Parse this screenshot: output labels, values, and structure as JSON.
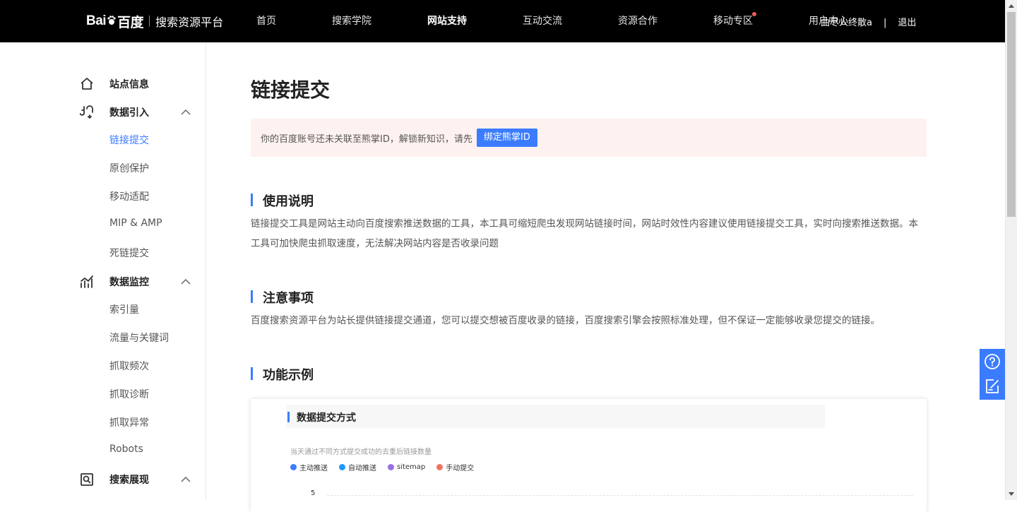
{
  "header": {
    "logo_mark": "Bai",
    "logo_mark2": "百度",
    "platform_name": "搜索资源平台",
    "nav": [
      {
        "label": "首页"
      },
      {
        "label": "搜索学院"
      },
      {
        "label": "网站支持"
      },
      {
        "label": "互动交流"
      },
      {
        "label": "资源合作"
      },
      {
        "label": "移动专区"
      },
      {
        "label": "用户中心"
      }
    ],
    "username": "曲尽人终散a",
    "separator": "|",
    "logout": "退出"
  },
  "sidebar": {
    "site_info": "站点信息",
    "data_import": {
      "title": "数据引入",
      "items": [
        "链接提交",
        "原创保护",
        "移动适配",
        "MIP & AMP",
        "死链提交"
      ]
    },
    "data_monitor": {
      "title": "数据监控",
      "items": [
        "索引量",
        "流量与关键词",
        "抓取频次",
        "抓取诊断",
        "抓取异常",
        "Robots"
      ]
    },
    "search_display": {
      "title": "搜索展现"
    }
  },
  "main": {
    "title": "链接提交",
    "notice_text": "你的百度账号还未关联至熊掌ID，解锁新知识，请先",
    "notice_button": "绑定熊掌ID",
    "usage_title": "使用说明",
    "usage_text": "链接提交工具是网站主动向百度搜索推送数据的工具，本工具可缩短爬虫发现网站链接时间，网站时效性内容建议使用链接提交工具，实时向搜索推送数据。本工具可加快爬虫抓取速度，无法解决网站内容是否收录问题",
    "notes_title": "注意事项",
    "notes_text": "百度搜索资源平台为站长提供链接提交通道，您可以提交想被百度收录的链接，百度搜索引擎会按照标准处理，但不保证一定能够收录您提交的链接。",
    "example_title": "功能示例",
    "example": {
      "card_title": "数据提交方式",
      "desc": "当天通过不同方式提交成功的去重后链接数量",
      "legend": [
        {
          "label": "主动推送",
          "color": "#3b7cff"
        },
        {
          "label": "自动推送",
          "color": "#1e96ff"
        },
        {
          "label": "sitemap",
          "color": "#9b6fe4"
        },
        {
          "label": "手动提交",
          "color": "#f0735f"
        }
      ],
      "y_tick": "5"
    }
  },
  "colors": {
    "accent": "#3b7cff",
    "topbar": "#000000",
    "notice_bg": "#fef2f0",
    "nav_dot": "#f05a5a"
  }
}
